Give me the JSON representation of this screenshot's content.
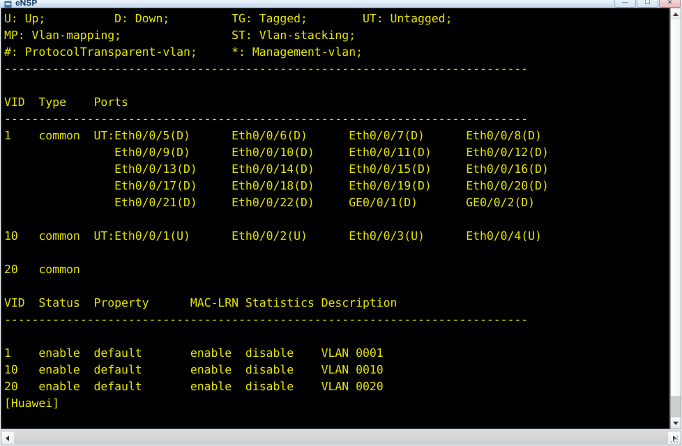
{
  "window": {
    "title": "eNSP",
    "icon": "ensp-app-icon",
    "buttons": [
      {
        "name": "minimize-button",
        "glyph": "—"
      },
      {
        "name": "maximize-button",
        "glyph": "☐"
      },
      {
        "name": "close-button",
        "glyph": "✕"
      }
    ]
  },
  "terminal": {
    "foreground": "#e2e200",
    "background": "#000000",
    "lines": [
      "U: Up;          D: Down;         TG: Tagged;        UT: Untagged;",
      "MP: Vlan-mapping;                ST: Vlan-stacking;",
      "#: ProtocolTransparent-vlan;     *: Management-vlan;",
      "----------------------------------------------------------------------------",
      "",
      "VID  Type    Ports",
      "----------------------------------------------------------------------------",
      "1    common  UT:Eth0/0/5(D)      Eth0/0/6(D)      Eth0/0/7(D)      Eth0/0/8(D)",
      "                Eth0/0/9(D)      Eth0/0/10(D)     Eth0/0/11(D)     Eth0/0/12(D)",
      "                Eth0/0/13(D)     Eth0/0/14(D)     Eth0/0/15(D)     Eth0/0/16(D)",
      "                Eth0/0/17(D)     Eth0/0/18(D)     Eth0/0/19(D)     Eth0/0/20(D)",
      "                Eth0/0/21(D)     Eth0/0/22(D)     GE0/0/1(D)       GE0/0/2(D)",
      "",
      "10   common  UT:Eth0/0/1(U)      Eth0/0/2(U)      Eth0/0/3(U)      Eth0/0/4(U)",
      "",
      "20   common",
      "",
      "VID  Status  Property      MAC-LRN Statistics Description",
      "----------------------------------------------------------------------------",
      "",
      "1    enable  default       enable  disable    VLAN 0001",
      "10   enable  default       enable  disable    VLAN 0010",
      "20   enable  default       enable  disable    VLAN 0020",
      "[Huawei]"
    ]
  },
  "scrollbars": {
    "vertical": {
      "up_glyph": "▲",
      "down_glyph": "▼"
    },
    "horizontal": {
      "left_glyph": "◀",
      "right_glyph": "▶"
    }
  }
}
